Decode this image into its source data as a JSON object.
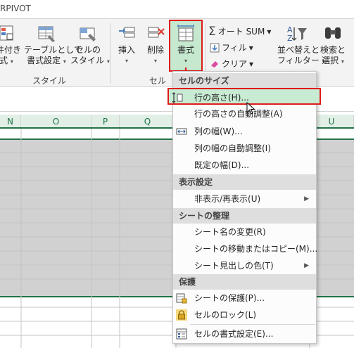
{
  "tabstrip": {
    "title": "RPIVOT"
  },
  "ribbon": {
    "styles_group": {
      "label": "スタイル",
      "cond_format_line1": "件付き",
      "cond_format_line2": "式",
      "table_format_line1": "テーブルとして",
      "table_format_line2": "書式設定",
      "cell_style_line1": "セルの",
      "cell_style_line2": "スタイル"
    },
    "cells_group": {
      "label": "セル",
      "insert": "挿入",
      "delete": "削除",
      "format": "書式"
    },
    "edit_group": {
      "autosum": "オート SUM",
      "fill": "フィル",
      "clear": "クリア",
      "sort_line1": "並べ替えと",
      "sort_line2": "フィルター",
      "find_line1": "検索と",
      "find_line2": "選択"
    }
  },
  "columns": [
    "N",
    "O",
    "P",
    "Q",
    "U"
  ],
  "menu": {
    "sections": {
      "cell_size": "セルのサイズ",
      "visibility": "表示設定",
      "organize": "シートの整理",
      "protection": "保護"
    },
    "items": {
      "row_height": "行の高さ(H)...",
      "autofit_row": "行の高さの自動調整(A)",
      "col_width": "列の幅(W)...",
      "autofit_col": "列の幅の自動調整(I)",
      "default_width": "既定の幅(D)...",
      "hide_unhide": "非表示/再表示(U)",
      "rename_sheet": "シート名の変更(R)",
      "move_copy": "シートの移動またはコピー(M)...",
      "tab_color": "シート見出しの色(T)",
      "protect_sheet": "シートの保護(P)...",
      "lock_cell": "セルのロック(L)",
      "format_cells": "セルの書式設定(E)..."
    }
  },
  "colors": {
    "excel_green": "#217346",
    "highlight": "#e01b1b",
    "selection_fill": "#d1d1d1"
  }
}
